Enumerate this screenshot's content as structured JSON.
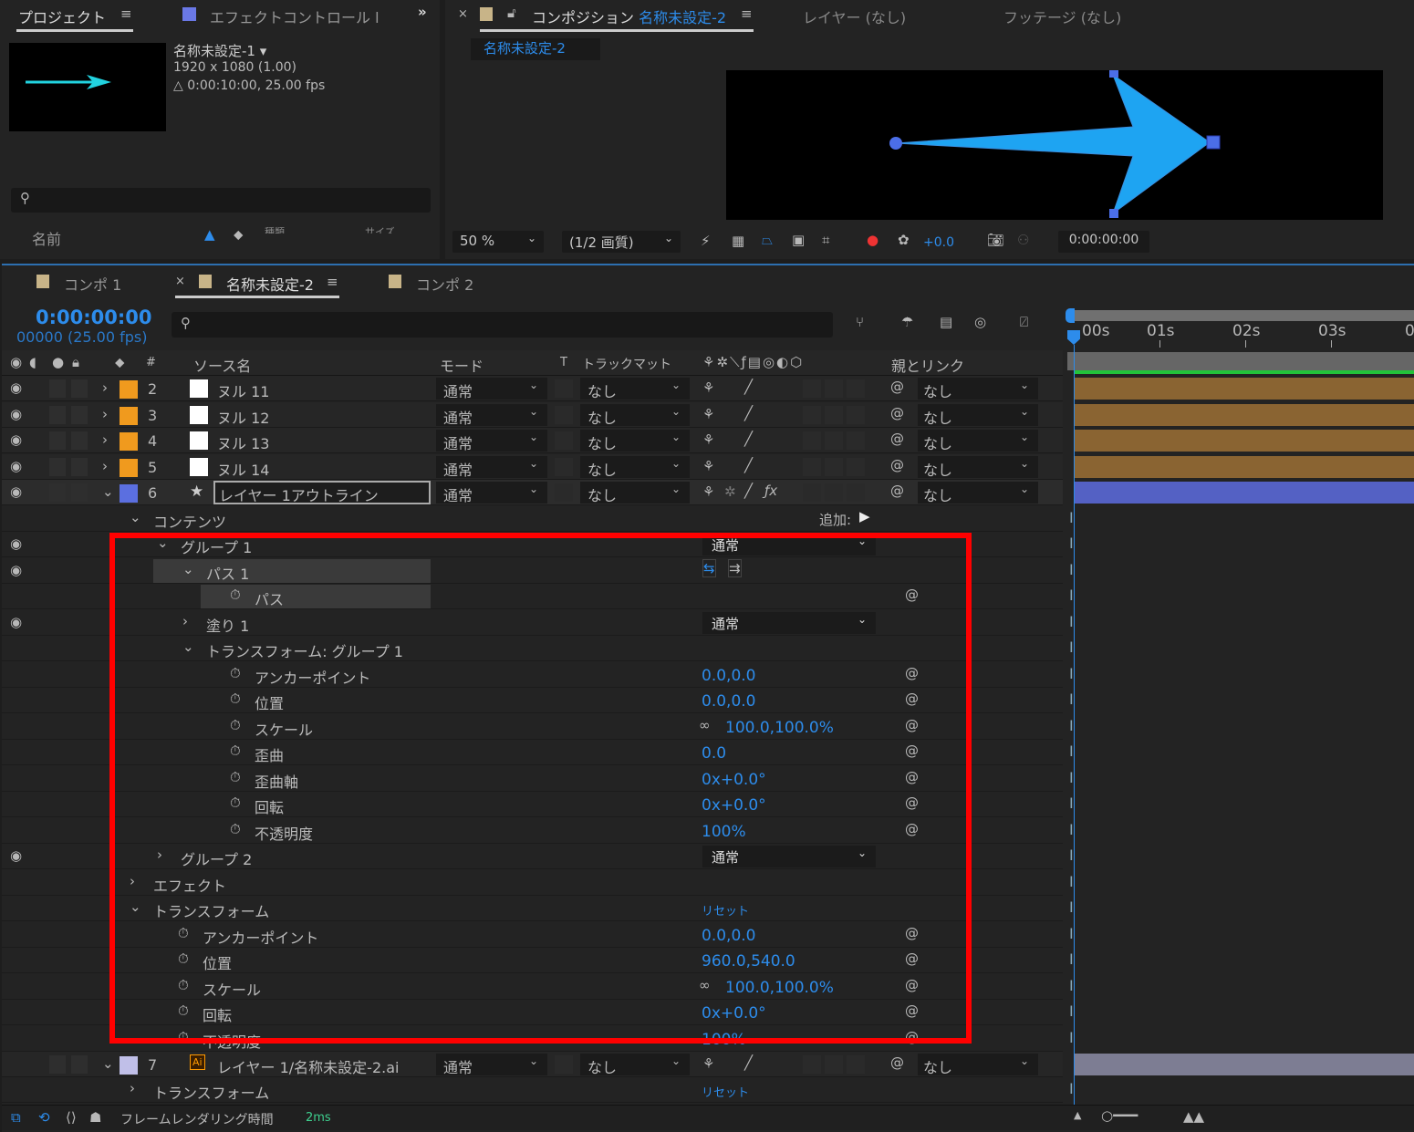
{
  "project": {
    "tab": "プロジェクト",
    "effects_tab": "エフェクトコントロール l",
    "comp_name": "名称未設定-1 ▾",
    "resolution": "1920 x 1080 (1.00)",
    "duration": "△ 0:00:10:00, 25.00 fps",
    "col_name": "名前",
    "col_type": "種類",
    "col_size": "サイズ"
  },
  "viewer": {
    "tab_comp_prefix": "コンポジション",
    "tab_comp_name": "名称未設定-2",
    "tab_layer": "レイヤー (なし)",
    "tab_footage": "フッテージ (なし)",
    "subtab": "名称未設定-2",
    "zoom": "50 %",
    "quality": "(1/2 画質)",
    "exposure": "+0.0",
    "timecode": "0:00:00:00"
  },
  "timeline": {
    "tabs": [
      "コンポ 1",
      "名称未設定-2",
      "コンポ 2"
    ],
    "active_tab": 1,
    "time": "0:00:00:00",
    "frames": "00000 (25.00 fps)",
    "headers": {
      "num": "#",
      "source": "ソース名",
      "mode": "モード",
      "t": "T",
      "trackmatte": "トラックマット",
      "parent": "親とリンク"
    },
    "ruler": [
      "00s",
      "01s",
      "02s",
      "03s",
      "0"
    ],
    "colors": {
      "accent": "#2d8ceb",
      "null_label": "#f09a1e",
      "shape_label": "#5b6fe0",
      "ai_label": "#c0bfe8",
      "null_bar": "#8a6432",
      "shape_bar": "#5461c4",
      "ai_bar": "#7d7d93",
      "highlight": "#ff0000"
    },
    "layers": [
      {
        "num": "2",
        "name": "ヌル 11",
        "mode": "通常",
        "matte": "なし",
        "parent": "なし",
        "type": "null"
      },
      {
        "num": "3",
        "name": "ヌル 12",
        "mode": "通常",
        "matte": "なし",
        "parent": "なし",
        "type": "null"
      },
      {
        "num": "4",
        "name": "ヌル 13",
        "mode": "通常",
        "matte": "なし",
        "parent": "なし",
        "type": "null"
      },
      {
        "num": "5",
        "name": "ヌル 14",
        "mode": "通常",
        "matte": "なし",
        "parent": "なし",
        "type": "null"
      },
      {
        "num": "6",
        "name": "レイヤー 1アウトライン",
        "mode": "通常",
        "matte": "なし",
        "parent": "なし",
        "type": "shape"
      }
    ],
    "properties": [
      {
        "label": "コンテンツ",
        "indent": 140,
        "chev": "down",
        "value": "追加:",
        "kind": "add"
      },
      {
        "label": "グループ 1",
        "indent": 170,
        "chev": "down",
        "eye": true,
        "value": "通常",
        "kind": "dd"
      },
      {
        "label": "パス 1",
        "indent": 198,
        "chev": "down",
        "eye": true,
        "kind": "pathdir",
        "hl": true
      },
      {
        "label": "パス",
        "indent": 250,
        "sw": true,
        "kind": "link",
        "hl": true
      },
      {
        "label": "塗り 1",
        "indent": 198,
        "chev": "right",
        "eye": true,
        "value": "通常",
        "kind": "dd"
      },
      {
        "label": "トランスフォーム: グループ 1",
        "indent": 198,
        "chev": "down"
      },
      {
        "label": "アンカーポイント",
        "indent": 250,
        "sw": true,
        "value": "0.0,0.0",
        "kind": "val"
      },
      {
        "label": "位置",
        "indent": 250,
        "sw": true,
        "value": "0.0,0.0",
        "kind": "val"
      },
      {
        "label": "スケール",
        "indent": 250,
        "sw": true,
        "value": "100.0,100.0%",
        "kind": "chain"
      },
      {
        "label": "歪曲",
        "indent": 250,
        "sw": true,
        "value": "0.0",
        "kind": "val"
      },
      {
        "label": "歪曲軸",
        "indent": 250,
        "sw": true,
        "value": "0x+0.0°",
        "kind": "val"
      },
      {
        "label": "回転",
        "indent": 250,
        "sw": true,
        "value": "0x+0.0°",
        "kind": "val"
      },
      {
        "label": "不透明度",
        "indent": 250,
        "sw": true,
        "value": "100%",
        "kind": "val"
      },
      {
        "label": "グループ 2",
        "indent": 170,
        "chev": "right",
        "eye": true,
        "value": "通常",
        "kind": "dd"
      },
      {
        "label": "エフェクト",
        "indent": 140,
        "chev": "right"
      },
      {
        "label": "トランスフォーム",
        "indent": 140,
        "chev": "down",
        "value": "リセット",
        "kind": "reset"
      },
      {
        "label": "アンカーポイント",
        "indent": 193,
        "sw": true,
        "value": "0.0,0.0",
        "kind": "val"
      },
      {
        "label": "位置",
        "indent": 193,
        "sw": true,
        "value": "960.0,540.0",
        "kind": "val"
      },
      {
        "label": "スケール",
        "indent": 193,
        "sw": true,
        "value": "100.0,100.0%",
        "kind": "chain"
      },
      {
        "label": "回転",
        "indent": 193,
        "sw": true,
        "value": "0x+0.0°",
        "kind": "val"
      },
      {
        "label": "不透明度",
        "indent": 193,
        "sw": true,
        "value": "100%",
        "kind": "val"
      }
    ],
    "layer7": {
      "num": "7",
      "name": "レイヤー 1/名称未設定-2.ai",
      "mode": "通常",
      "matte": "なし",
      "parent": "なし"
    },
    "layer7_prop": {
      "label": "トランスフォーム",
      "value": "リセット"
    },
    "status": {
      "label": "フレームレンダリング時間",
      "value": "2ms"
    }
  }
}
